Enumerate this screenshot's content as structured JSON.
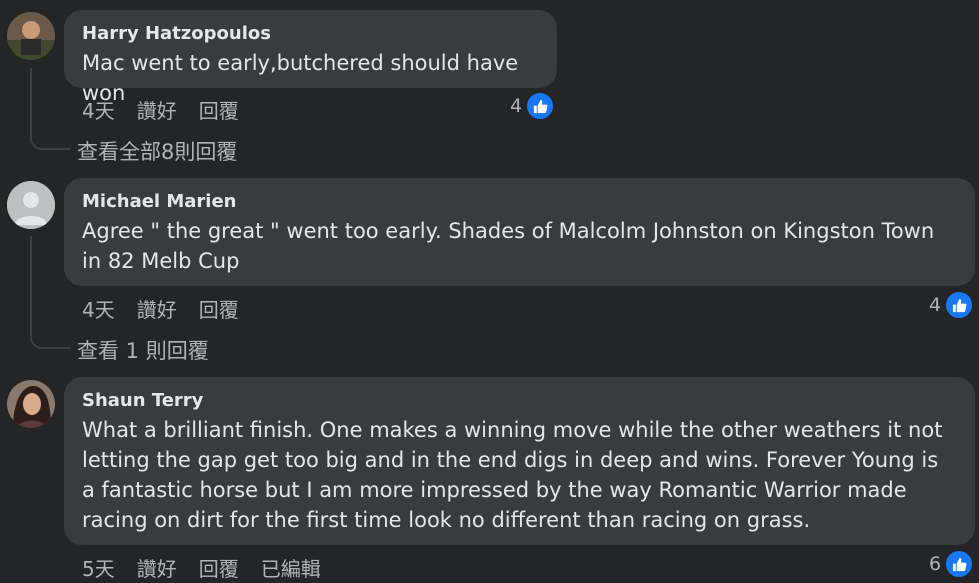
{
  "comments": [
    {
      "author": "Harry Hatzopoulos",
      "text": "Mac went to early,butchered should have won",
      "time": "4天",
      "like_label": "讚好",
      "reply_label": "回覆",
      "reactions": "4",
      "view_replies": "查看全部8則回覆"
    },
    {
      "author": "Michael Marien",
      "text": "Agree \" the great \" went too early. Shades of Malcolm Johnston on Kingston Town in 82 Melb Cup",
      "time": "4天",
      "like_label": "讚好",
      "reply_label": "回覆",
      "reactions": "4",
      "view_replies": "查看 1 則回覆"
    },
    {
      "author": "Shaun Terry",
      "text": "What a brilliant finish. One makes a winning move while the other weathers it not letting the gap get too big and in the end digs in deep and wins. Forever Young is a fantastic horse but I am more impressed by the way Romantic Warrior made racing on dirt for the first time look no different than racing on grass.",
      "time": "5天",
      "like_label": "讚好",
      "reply_label": "回覆",
      "edited_label": "已編輯",
      "reactions": "6"
    }
  ],
  "colors": {
    "background": "#242526",
    "bubble": "#3a3b3c",
    "text": "#e4e6eb",
    "secondary_text": "#b0b3b8",
    "like_blue": "#1877f2"
  }
}
